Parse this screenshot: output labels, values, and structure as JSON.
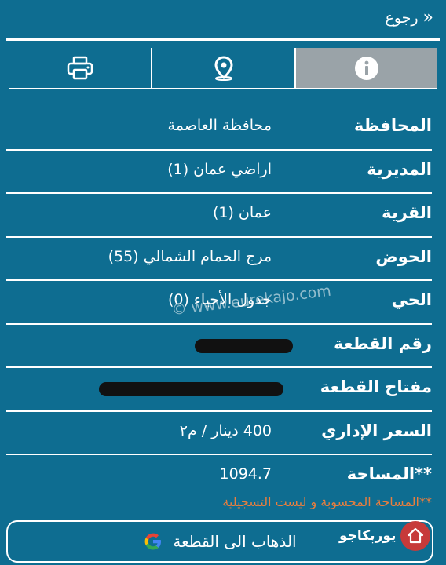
{
  "header": {
    "back_label": "رجوع"
  },
  "tabs": [
    {
      "name": "info",
      "icon": "info-icon"
    },
    {
      "name": "location",
      "icon": "location-pin-icon"
    },
    {
      "name": "print",
      "icon": "printer-icon"
    }
  ],
  "fields": [
    {
      "label": "المحافظة",
      "value": "محافظة العاصمة"
    },
    {
      "label": "المديرية",
      "value": "اراضي عمان (1)"
    },
    {
      "label": "القرية",
      "value": "عمان (1)"
    },
    {
      "label": "الحوض",
      "value": "مرج الحمام الشمالي (55)"
    },
    {
      "label": "الحي",
      "value": "جدول الأحياء (0)"
    },
    {
      "label": "رقم القطعة",
      "value": ""
    },
    {
      "label": "مفتاح القطعة",
      "value": ""
    },
    {
      "label": "السعر الإداري",
      "value": "400 دينار / م٢"
    },
    {
      "label": "**المساحة",
      "value": "1094.7"
    }
  ],
  "note": "**المساحة المحسوبة و ليست التسجيلية",
  "watermark": "© www.eurekajo.com",
  "go_button": {
    "label": "الذهاب الى القطعة"
  },
  "logo": {
    "text": "يورېكاجو"
  },
  "colors": {
    "background": "#0e6d91",
    "accent_note": "#e97e3e",
    "active_tab": "#9aa3a8"
  }
}
